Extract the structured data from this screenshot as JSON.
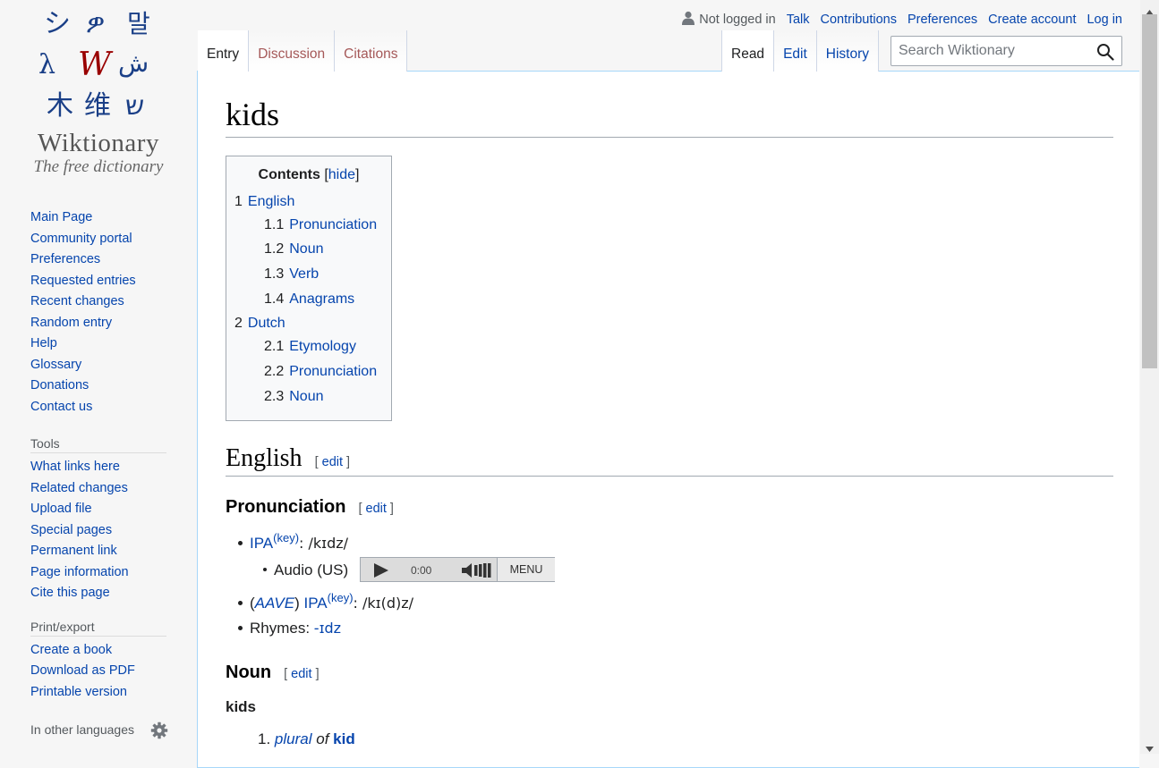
{
  "logo": {
    "title": "Wiktionary",
    "subtitle": "The free dictionary",
    "glyphs": [
      "シ",
      "ዎ",
      "말",
      "λ",
      "W",
      "ش",
      "木",
      "维",
      "ש"
    ]
  },
  "sidebar": {
    "navigation": [
      "Main Page",
      "Community portal",
      "Preferences",
      "Requested entries",
      "Recent changes",
      "Random entry",
      "Help",
      "Glossary",
      "Donations",
      "Contact us"
    ],
    "tools_heading": "Tools",
    "tools": [
      "What links here",
      "Related changes",
      "Upload file",
      "Special pages",
      "Permanent link",
      "Page information",
      "Cite this page"
    ],
    "print_heading": "Print/export",
    "print": [
      "Create a book",
      "Download as PDF",
      "Printable version"
    ],
    "languages_heading": "In other languages"
  },
  "personal": {
    "not_logged_in": "Not logged in",
    "links": [
      "Talk",
      "Contributions",
      "Preferences",
      "Create account",
      "Log in"
    ]
  },
  "tabs": {
    "left": [
      "Entry",
      "Discussion",
      "Citations"
    ],
    "right": [
      "Read",
      "Edit",
      "History"
    ]
  },
  "search": {
    "placeholder": "Search Wiktionary"
  },
  "page": {
    "title": "kids",
    "toc": {
      "title": "Contents",
      "hide": "hide",
      "items": [
        {
          "num": "1",
          "text": "English"
        },
        {
          "num": "1.1",
          "text": "Pronunciation"
        },
        {
          "num": "1.2",
          "text": "Noun"
        },
        {
          "num": "1.3",
          "text": "Verb"
        },
        {
          "num": "1.4",
          "text": "Anagrams"
        },
        {
          "num": "2",
          "text": "Dutch"
        },
        {
          "num": "2.1",
          "text": "Etymology"
        },
        {
          "num": "2.2",
          "text": "Pronunciation"
        },
        {
          "num": "2.3",
          "text": "Noun"
        }
      ]
    },
    "edit_label": "edit",
    "english_heading": "English",
    "pronunciation_heading": "Pronunciation",
    "ipa_label": "IPA",
    "key_label": "(key)",
    "ipa1": ": /kɪdz/",
    "audio_label": "Audio (US)",
    "player": {
      "time": "0:00",
      "menu": "MENU"
    },
    "aave_open": "(",
    "aave": "AAVE",
    "aave_close": ")",
    "ipa2": ": /kɪ(d)z/",
    "rhymes_label": "Rhymes: ",
    "rhymes_value": "-ɪdz",
    "noun_heading": "Noun",
    "headword": "kids",
    "def_num": "1.",
    "def_plural": "plural",
    "def_of": "of",
    "def_kid": "kid"
  }
}
